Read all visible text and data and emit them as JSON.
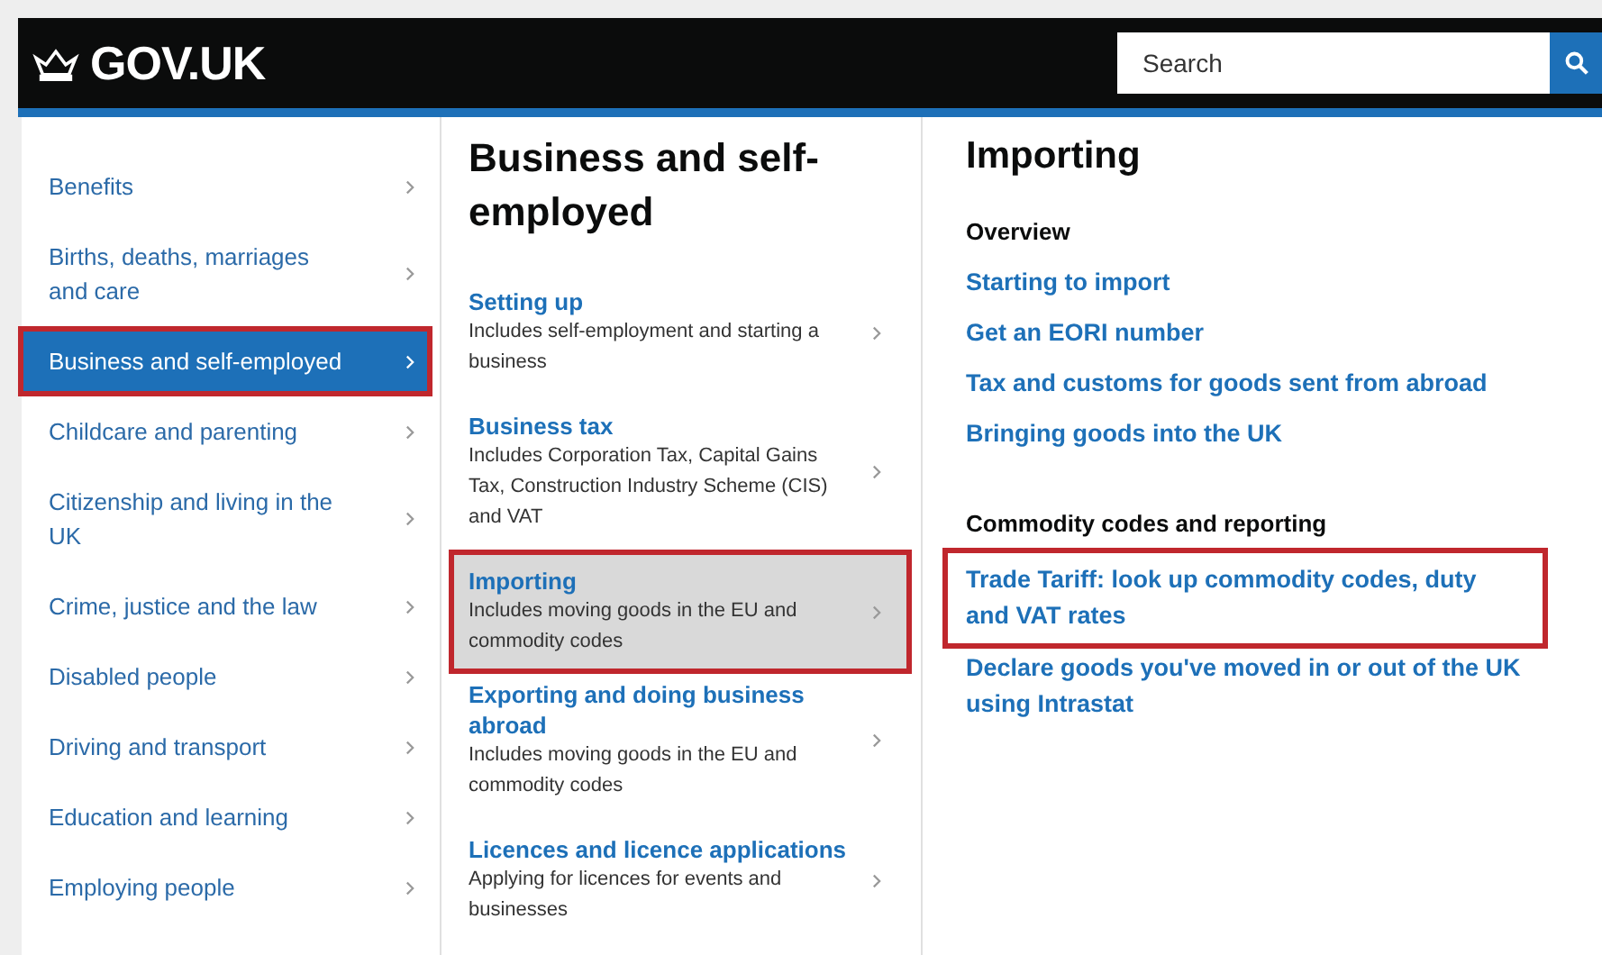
{
  "header": {
    "logo": "GOV.UK",
    "search": {
      "placeholder": "Search"
    }
  },
  "topics": [
    {
      "label": "Benefits",
      "selected": false,
      "highlighted": false
    },
    {
      "label": "Births, deaths, marriages and care",
      "selected": false,
      "highlighted": false
    },
    {
      "label": "Business and self-employed",
      "selected": true,
      "highlighted": true
    },
    {
      "label": "Childcare and parenting",
      "selected": false,
      "highlighted": false
    },
    {
      "label": "Citizenship and living in the UK",
      "selected": false,
      "highlighted": false
    },
    {
      "label": "Crime, justice and the law",
      "selected": false,
      "highlighted": false
    },
    {
      "label": "Disabled people",
      "selected": false,
      "highlighted": false
    },
    {
      "label": "Driving and transport",
      "selected": false,
      "highlighted": false
    },
    {
      "label": "Education and learning",
      "selected": false,
      "highlighted": false
    },
    {
      "label": "Employing people",
      "selected": false,
      "highlighted": false
    }
  ],
  "section": {
    "title": "Business and self-employed",
    "items": [
      {
        "title": "Setting up",
        "description": "Includes self-employment and starting a business",
        "selected": false,
        "highlighted": false
      },
      {
        "title": "Business tax",
        "description": "Includes Corporation Tax, Capital Gains Tax, Construction Industry Scheme (CIS) and VAT",
        "selected": false,
        "highlighted": false
      },
      {
        "title": "Importing",
        "description": "Includes moving goods in the EU and commodity codes",
        "selected": true,
        "highlighted": true
      },
      {
        "title": "Exporting and doing business abroad",
        "description": "Includes moving goods in the EU and commodity codes",
        "selected": false,
        "highlighted": false
      },
      {
        "title": "Licences and licence applications",
        "description": "Applying for licences for events and businesses",
        "selected": false,
        "highlighted": false
      }
    ]
  },
  "subsection": {
    "title": "Importing",
    "groups": [
      {
        "heading": "Overview",
        "links": [
          {
            "label": "Starting to import",
            "highlighted": false
          },
          {
            "label": "Get an EORI number",
            "highlighted": false
          },
          {
            "label": "Tax and customs for goods sent from abroad",
            "highlighted": false
          },
          {
            "label": "Bringing goods into the UK",
            "highlighted": false
          }
        ]
      },
      {
        "heading": "Commodity codes and reporting",
        "links": [
          {
            "label": "Trade Tariff: look up commodity codes, duty and VAT rates",
            "highlighted": true
          },
          {
            "label": "Declare goods you've moved in or out of the UK using Intrastat",
            "highlighted": false
          }
        ]
      }
    ]
  }
}
